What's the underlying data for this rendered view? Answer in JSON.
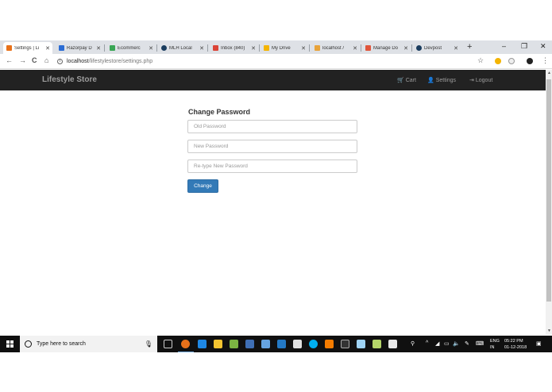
{
  "browser": {
    "tabs": [
      {
        "label": "Settings | Li",
        "color": "#e8711a"
      },
      {
        "label": "Razorpay D",
        "color": "#2b6cd4"
      },
      {
        "label": "Ecommerc",
        "color": "#3aa655"
      },
      {
        "label": "MLH Local",
        "color": "#1a3c5e"
      },
      {
        "label": "Inbox (840)",
        "color": "#db4437"
      },
      {
        "label": "My Drive",
        "color": "#f4b400"
      },
      {
        "label": "localhost /",
        "color": "#e8a33a"
      },
      {
        "label": "Manage Do",
        "color": "#e0553b"
      },
      {
        "label": "Devpost",
        "color": "#1a3c5e"
      }
    ],
    "new_tab": "+",
    "window_controls": {
      "minimize": "–",
      "maximize": "❐",
      "close": "✕"
    },
    "nav": {
      "back": "←",
      "forward": "→",
      "reload": "C",
      "home": "⌂"
    },
    "address": {
      "host": "localhost",
      "path": "/lifestylestore/settings.php"
    },
    "star": "☆"
  },
  "app": {
    "brand": "Lifestyle Store",
    "nav": {
      "cart": "Cart",
      "settings": "Settings",
      "logout": "Logout"
    },
    "icons": {
      "cart": "🛒",
      "settings": "👤",
      "logout": "⇥"
    }
  },
  "form": {
    "title": "Change Password",
    "old_password_placeholder": "Old Password",
    "new_password_placeholder": "New Password",
    "retype_password_placeholder": "Re-type New Password",
    "submit_label": "Change"
  },
  "taskbar": {
    "search_placeholder": "Type here to search",
    "language": "ENG",
    "region": "IN",
    "time": "05:22 PM",
    "date": "01-12-2018",
    "notifications": "4"
  },
  "colors": {
    "navbar_bg": "#222222",
    "navbar_text": "#9d9d9d",
    "primary_button": "#337ab7"
  }
}
